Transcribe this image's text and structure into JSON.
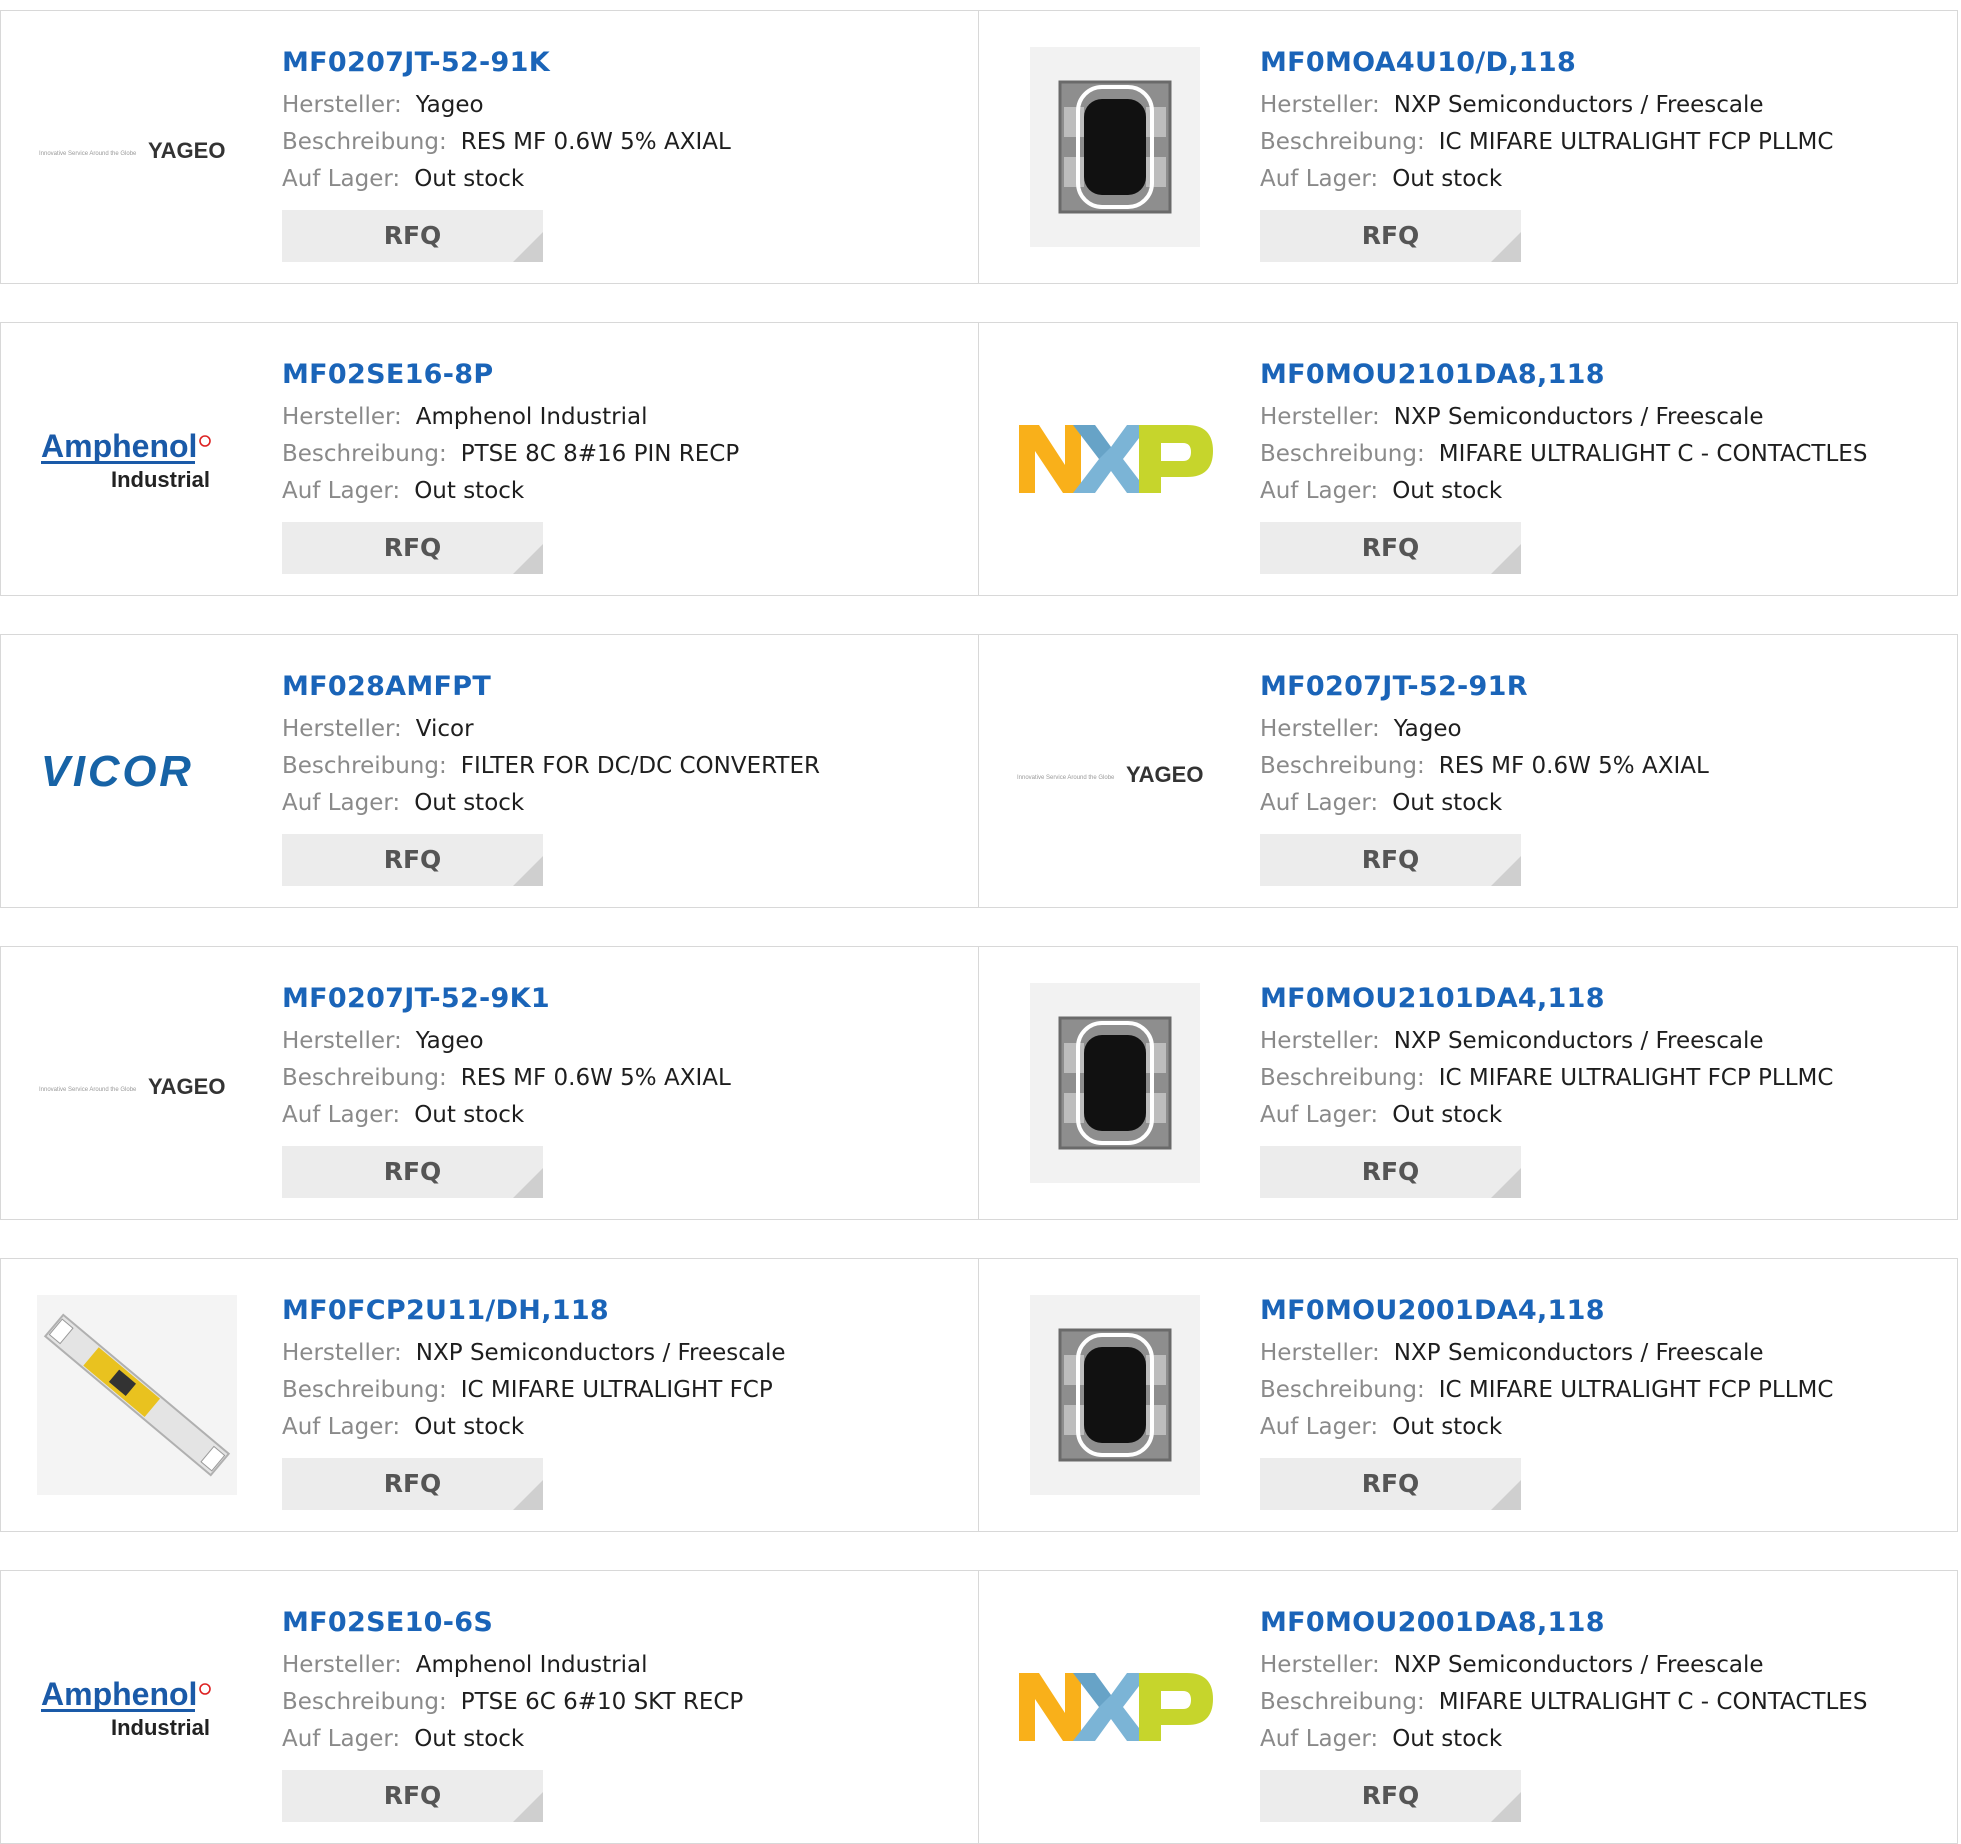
{
  "labels": {
    "manufacturer": "Hersteller:",
    "description": "Beschreibung:",
    "stock": "Auf Lager:",
    "rfq": "RFQ"
  },
  "rows": [
    [
      {
        "part": "MF0207JT-52-91K",
        "manufacturer": "Yageo",
        "description": "RES MF 0.6W 5% AXIAL",
        "stock": "Out stock",
        "image": "yageo-logo",
        "logo_text": "YAGEO",
        "logo_tagline": "Innovative Service Around the Globe"
      },
      {
        "part": "MF0MOA4U10/D,118",
        "manufacturer": "NXP Semiconductors / Freescale",
        "description": "IC MIFARE ULTRALIGHT FCP PLLMC",
        "stock": "Out stock",
        "image": "chip-module-photo"
      }
    ],
    [
      {
        "part": "MF02SE16-8P",
        "manufacturer": "Amphenol Industrial",
        "description": "PTSE 8C 8#16 PIN RECP",
        "stock": "Out stock",
        "image": "amphenol-logo",
        "logo_text": "Amphenol",
        "logo_sub": "Industrial"
      },
      {
        "part": "MF0MOU2101DA8,118",
        "manufacturer": "NXP Semiconductors / Freescale",
        "description": "MIFARE ULTRALIGHT C - CONTACTLES",
        "stock": "Out stock",
        "image": "nxp-logo"
      }
    ],
    [
      {
        "part": "MF028AMFPT",
        "manufacturer": "Vicor",
        "description": "FILTER FOR DC/DC CONVERTER",
        "stock": "Out stock",
        "image": "vicor-logo",
        "logo_text": "VICOR"
      },
      {
        "part": "MF0207JT-52-91R",
        "manufacturer": "Yageo",
        "description": "RES MF 0.6W 5% AXIAL",
        "stock": "Out stock",
        "image": "yageo-logo",
        "logo_text": "YAGEO",
        "logo_tagline": "Innovative Service Around the Globe"
      }
    ],
    [
      {
        "part": "MF0207JT-52-9K1",
        "manufacturer": "Yageo",
        "description": "RES MF 0.6W 5% AXIAL",
        "stock": "Out stock",
        "image": "yageo-logo",
        "logo_text": "YAGEO",
        "logo_tagline": "Innovative Service Around the Globe"
      },
      {
        "part": "MF0MOU2101DA4,118",
        "manufacturer": "NXP Semiconductors / Freescale",
        "description": "IC MIFARE ULTRALIGHT FCP PLLMC",
        "stock": "Out stock",
        "image": "chip-module-photo"
      }
    ],
    [
      {
        "part": "MF0FCP2U11/DH,118",
        "manufacturer": "NXP Semiconductors / Freescale",
        "description": "IC MIFARE ULTRALIGHT FCP",
        "stock": "Out stock",
        "image": "flex-strip-photo"
      },
      {
        "part": "MF0MOU2001DA4,118",
        "manufacturer": "NXP Semiconductors / Freescale",
        "description": "IC MIFARE ULTRALIGHT FCP PLLMC",
        "stock": "Out stock",
        "image": "chip-module-photo"
      }
    ],
    [
      {
        "part": "MF02SE10-6S",
        "manufacturer": "Amphenol Industrial",
        "description": "PTSE 6C 6#10 SKT RECP",
        "stock": "Out stock",
        "image": "amphenol-logo",
        "logo_text": "Amphenol",
        "logo_sub": "Industrial"
      },
      {
        "part": "MF0MOU2001DA8,118",
        "manufacturer": "NXP Semiconductors / Freescale",
        "description": "MIFARE ULTRALIGHT C - CONTACTLES",
        "stock": "Out stock",
        "image": "nxp-logo"
      }
    ]
  ],
  "colors": {
    "part_link": "#1a64b8",
    "label_gray": "#8a8a8a",
    "rfq_bg": "#ececec",
    "nxp_orange": "#f9b01a",
    "nxp_blue": "#7bb4d6",
    "nxp_green": "#c6d52c",
    "vicor_blue": "#1763a6",
    "amphenol_blue": "#1a5aa8"
  }
}
